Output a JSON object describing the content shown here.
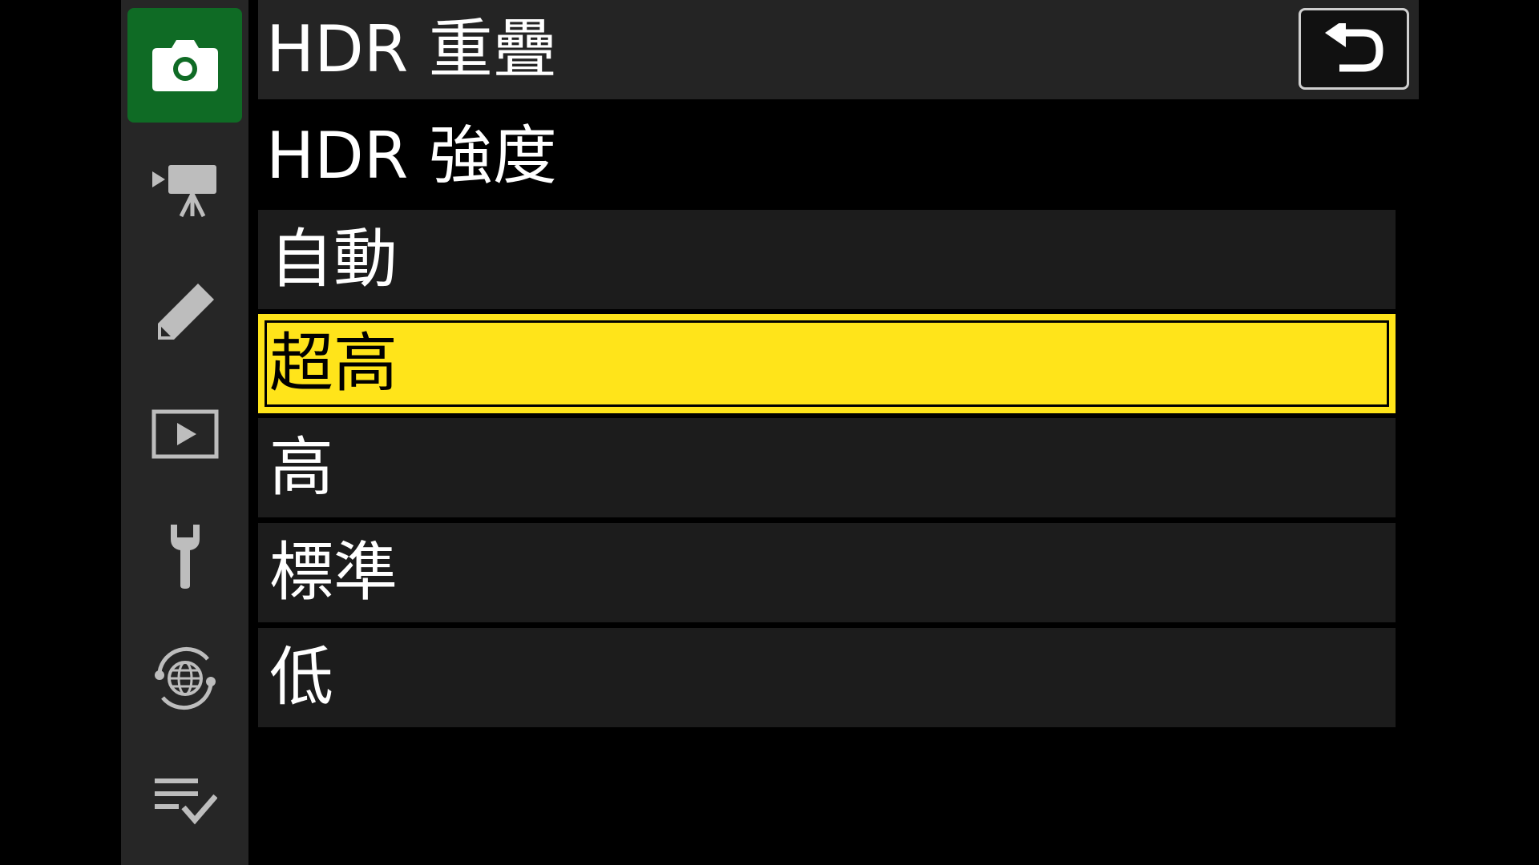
{
  "header": {
    "title": "HDR 重疊",
    "back_icon": "return-arrow-icon"
  },
  "section": {
    "title": "HDR 強度"
  },
  "sidebar": {
    "items": [
      {
        "icon": "camera-icon",
        "active": true
      },
      {
        "icon": "movie-camera-icon",
        "active": false
      },
      {
        "icon": "pencil-icon",
        "active": false
      },
      {
        "icon": "playback-icon",
        "active": false
      },
      {
        "icon": "wrench-icon",
        "active": false
      },
      {
        "icon": "network-globe-icon",
        "active": false
      },
      {
        "icon": "my-menu-checklist-icon",
        "active": false
      }
    ]
  },
  "options": [
    {
      "label": "自動",
      "selected": false
    },
    {
      "label": "超高",
      "selected": true
    },
    {
      "label": "高",
      "selected": false
    },
    {
      "label": "標準",
      "selected": false
    },
    {
      "label": "低",
      "selected": false
    }
  ],
  "colors": {
    "active_tab": "#0f6b25",
    "selection": "#ffe41a",
    "sidebar_bg": "#262626",
    "row_bg": "#1c1c1c"
  }
}
